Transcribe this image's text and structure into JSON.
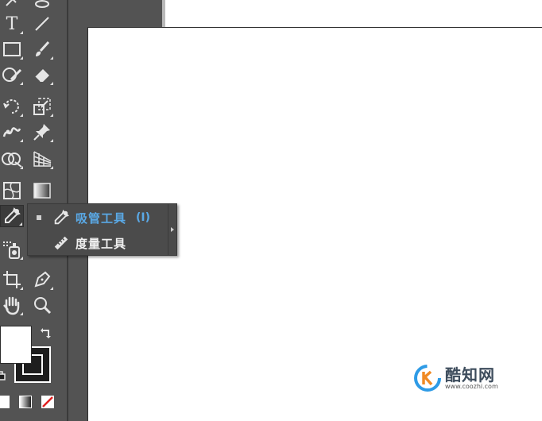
{
  "toolbar": {
    "type_tool_glyph": "T"
  },
  "flyout": {
    "items": [
      {
        "label": "吸管工具",
        "shortcut": "(I)",
        "active": true,
        "icon": "eyedropper-icon"
      },
      {
        "label": "度量工具",
        "shortcut": "",
        "active": false,
        "icon": "measure-ruler-icon"
      }
    ]
  },
  "colors": {
    "panel": "#535353",
    "accent": "#5aa9e6",
    "artboard": "#ffffff"
  },
  "watermark": {
    "name": "酷知网",
    "url": "www.coozhi.com"
  }
}
